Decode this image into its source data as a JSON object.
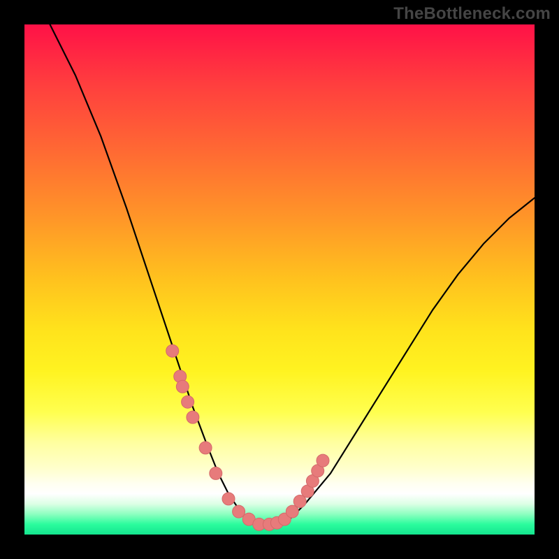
{
  "watermark": "TheBottleneck.com",
  "chart_data": {
    "type": "line",
    "title": "",
    "xlabel": "",
    "ylabel": "",
    "xlim": [
      0,
      100
    ],
    "ylim": [
      0,
      100
    ],
    "curve": {
      "x": [
        5,
        10,
        15,
        20,
        25,
        30,
        33,
        36,
        38,
        40,
        42,
        44,
        46,
        48,
        50,
        52,
        55,
        60,
        65,
        70,
        75,
        80,
        85,
        90,
        95,
        100
      ],
      "y_pct": [
        100,
        90,
        78,
        64,
        49,
        34,
        25,
        17,
        12,
        8,
        5,
        3,
        2,
        2,
        2,
        3,
        6,
        12,
        20,
        28,
        36,
        44,
        51,
        57,
        62,
        66
      ]
    },
    "markers": {
      "x": [
        29,
        30.5,
        31,
        32,
        33,
        35.5,
        37.5,
        40,
        42,
        44,
        46,
        48,
        49.5,
        51,
        52.5,
        54,
        55.5,
        56.5,
        57.5,
        58.5
      ],
      "y_pct": [
        36,
        31,
        29,
        26,
        23,
        17,
        12,
        7,
        4.5,
        3,
        2,
        2,
        2.3,
        3,
        4.5,
        6.5,
        8.5,
        10.5,
        12.5,
        14.5
      ]
    },
    "legend": [],
    "annotations": []
  },
  "colors": {
    "curve_stroke": "#000000",
    "marker_fill": "#e77b7b",
    "marker_stroke": "#d46a6a"
  }
}
